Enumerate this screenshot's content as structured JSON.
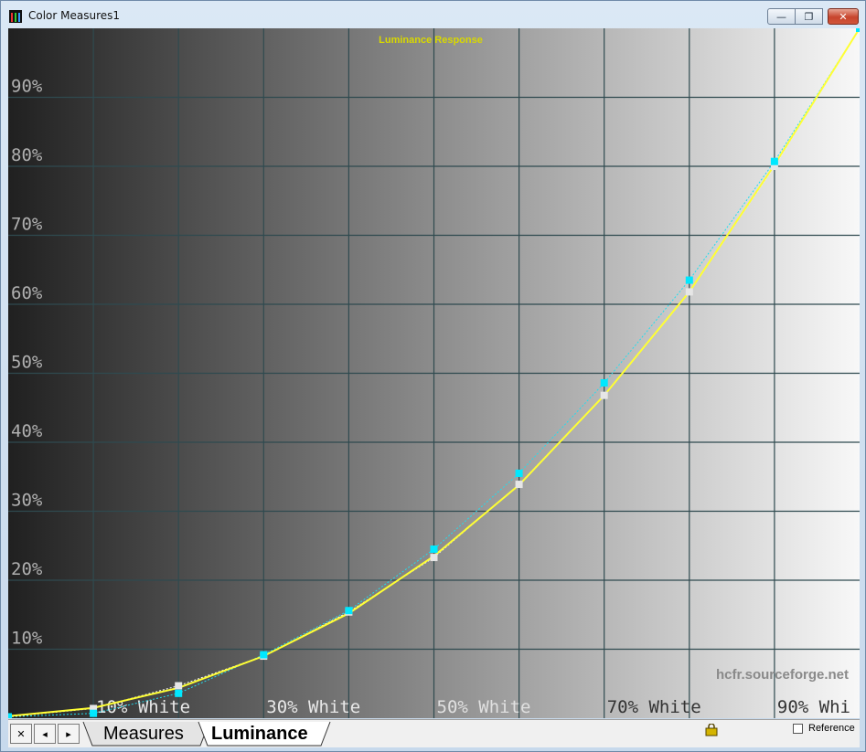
{
  "window": {
    "title": "Color Measures1",
    "minimize_glyph": "—",
    "maximize_glyph": "❐",
    "close_glyph": "✕"
  },
  "chart_data": {
    "type": "line",
    "title": "Luminance Response",
    "xlabel": "",
    "ylabel": "",
    "xlim": [
      0,
      100
    ],
    "ylim": [
      0,
      100
    ],
    "grid": true,
    "y_ticks": [
      "10%",
      "20%",
      "30%",
      "40%",
      "50%",
      "60%",
      "70%",
      "80%",
      "90%"
    ],
    "y_tick_values": [
      10,
      20,
      30,
      40,
      50,
      60,
      70,
      80,
      90
    ],
    "x_ticks": [
      "10% White",
      "30% White",
      "50% White",
      "70% White",
      "90% Whi"
    ],
    "x_tick_values": [
      10,
      30,
      50,
      70,
      90
    ],
    "watermark": "hcfr.sourceforge.net",
    "x": [
      0,
      10,
      20,
      30,
      40,
      50,
      60,
      70,
      80,
      90,
      100
    ],
    "series": [
      {
        "color": "#ffff33",
        "style": "solid",
        "values": [
          0.3,
          1.5,
          4.4,
          9.0,
          15.2,
          23.5,
          33.8,
          46.8,
          61.8,
          80.2,
          100
        ]
      },
      {
        "color": "#22ddee",
        "style": "dotted",
        "values": [
          0.2,
          0.7,
          3.6,
          9.2,
          15.6,
          24.5,
          35.5,
          48.6,
          63.5,
          80.7,
          100
        ]
      },
      {
        "color": "#ffffff",
        "style": "dotted",
        "values": [
          0.2,
          1.4,
          4.7,
          9.0,
          15.4,
          23.3,
          33.9,
          46.8,
          61.8,
          80.0,
          100
        ]
      }
    ],
    "colors": {
      "grid": "#2f4a4f",
      "tick_text_y": "#b0b0b0",
      "title": "#d8d800"
    }
  },
  "statusbar": {
    "nav": [
      "✕",
      "◂",
      "▸"
    ],
    "tabs": [
      "Measures",
      "Luminance"
    ],
    "active_tab": "Luminance",
    "reference_label": "Reference",
    "reference_checked": false
  }
}
